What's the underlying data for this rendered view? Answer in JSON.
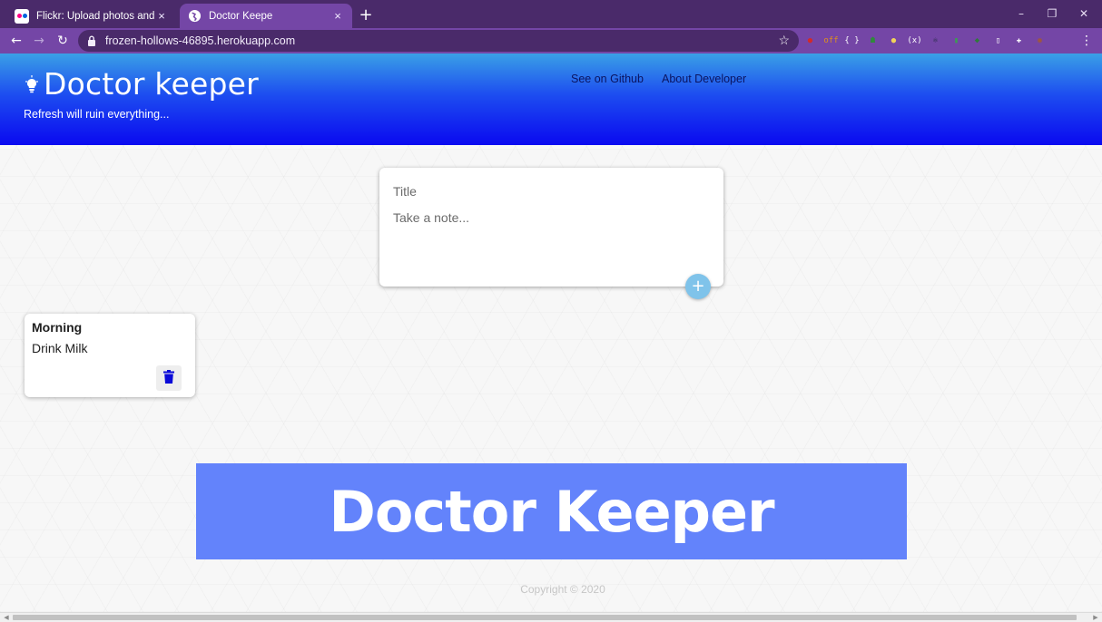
{
  "browser": {
    "tabs": [
      {
        "title": "Flickr: Upload photos and videos",
        "favicon": "flickr-icon",
        "active": false
      },
      {
        "title": "Doctor Keepe",
        "favicon": "globe-icon",
        "active": true
      }
    ],
    "close_glyph": "×",
    "new_tab_glyph": "+",
    "window_controls": {
      "minimize": "–",
      "restore": "❐",
      "close": "✕"
    },
    "nav": {
      "back": "←",
      "forward": "→",
      "reload": "↻"
    },
    "url": "frozen-hollows-46895.herokuapp.com",
    "bookmark_glyph": "☆",
    "menu_glyph": "⋮",
    "extensions": [
      {
        "name": "adblock-icon",
        "glyph": "●",
        "color": "#d12a2a"
      },
      {
        "name": "coupon-icon",
        "glyph": "off",
        "color": "#e0901b"
      },
      {
        "name": "json-viewer-icon",
        "glyph": "{ }",
        "color": "#7446a6"
      },
      {
        "name": "agent-icon",
        "glyph": "☗",
        "color": "#2f8a3a"
      },
      {
        "name": "egg-icon",
        "glyph": "●",
        "color": "#f1d25a"
      },
      {
        "name": "variable-icon",
        "glyph": "(x)",
        "color": "#7446a6"
      },
      {
        "name": "react-devtools-icon",
        "glyph": "⚛",
        "color": "#1c2a3a"
      },
      {
        "name": "bottle-icon",
        "glyph": "▮",
        "color": "#3d9b54"
      },
      {
        "name": "cube-icon",
        "glyph": "◆",
        "color": "#2f7a3a"
      },
      {
        "name": "reader-icon",
        "glyph": "▯",
        "color": "#7446a6"
      },
      {
        "name": "puzzle-icon",
        "glyph": "✚",
        "color": "#7446a6"
      },
      {
        "name": "profile-avatar-icon",
        "glyph": "◉",
        "color": "#a0583a"
      }
    ]
  },
  "app": {
    "brand": "Doctor keeper",
    "tagline": "Refresh will ruin everything...",
    "nav_links": [
      "See on Github",
      "About Developer"
    ],
    "create_note": {
      "title_placeholder": "Title",
      "content_placeholder": "Take a note...",
      "add_label": "+"
    },
    "notes": [
      {
        "title": "Morning",
        "content": "Drink Milk"
      }
    ],
    "banner_text": "Doctor Keeper",
    "copyright": "Copyright © 2020"
  },
  "colors": {
    "tab_strip": "#4a2a6a",
    "toolbar": "#7446a6",
    "header_top": "#3aa0e6",
    "header_bottom": "#0a09f0",
    "banner": "#6383fb",
    "delete_icon": "#0a0ad8",
    "add_button": "#7fc3ea"
  },
  "scrollbar": {
    "left_arrow": "◀",
    "right_arrow": "▶"
  }
}
